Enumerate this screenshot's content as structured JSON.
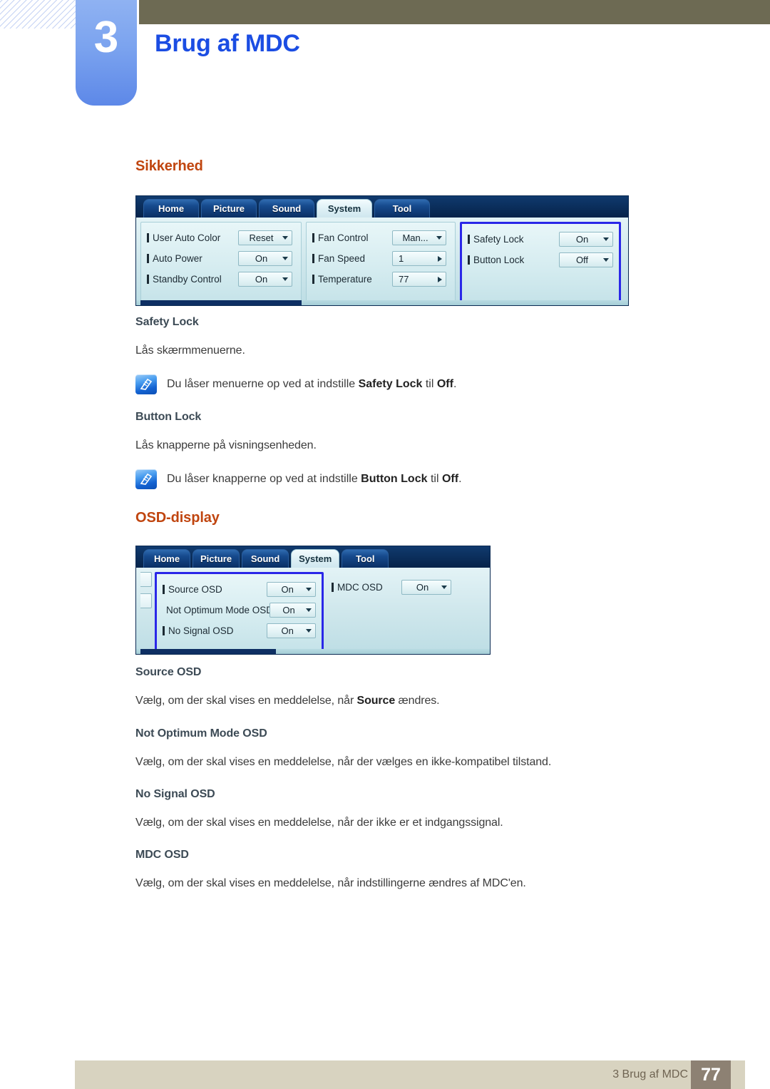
{
  "header": {
    "chapter_number": "3",
    "chapter_title": "Brug af MDC"
  },
  "sections": [
    {
      "heading": "Sikkerhed",
      "subsections": [
        {
          "title": "Safety Lock",
          "body": "Lås skærmmenuerne.",
          "note_pre": "Du låser menuerne op ved at indstille ",
          "note_bold1": "Safety Lock",
          "note_mid": " til ",
          "note_bold2": "Off",
          "note_post": "."
        },
        {
          "title": "Button Lock",
          "body": "Lås knapperne på visningsenheden.",
          "note_pre": "Du låser knapperne op ved at indstille ",
          "note_bold1": "Button Lock",
          "note_mid": " til ",
          "note_bold2": "Off",
          "note_post": "."
        }
      ]
    },
    {
      "heading": "OSD-display",
      "subsections": [
        {
          "title": "Source OSD",
          "body_pre": "Vælg, om der skal vises en meddelelse, når ",
          "body_bold": "Source",
          "body_post": " ændres."
        },
        {
          "title": "Not Optimum Mode OSD",
          "body": "Vælg, om der skal vises en meddelelse, når der vælges en ikke-kompatibel tilstand."
        },
        {
          "title": "No Signal OSD",
          "body": "Vælg, om der skal vises en meddelelse, når der ikke er et indgangssignal."
        },
        {
          "title": "MDC OSD",
          "body": "Vælg, om der skal vises en meddelelse, når indstillingerne ændres af MDC'en."
        }
      ]
    }
  ],
  "mdc_system": {
    "tabs": [
      "Home",
      "Picture",
      "Sound",
      "System",
      "Tool"
    ],
    "active_tab": "System",
    "group1": [
      {
        "label": "User Auto Color",
        "value": "Reset",
        "control": "dropdown"
      },
      {
        "label": "Auto Power",
        "value": "On",
        "control": "dropdown"
      },
      {
        "label": "Standby Control",
        "value": "On",
        "control": "dropdown"
      }
    ],
    "group2": [
      {
        "label": "Fan Control",
        "value": "Man...",
        "control": "dropdown"
      },
      {
        "label": "Fan Speed",
        "value": "1",
        "control": "stepper"
      },
      {
        "label": "Temperature",
        "value": "77",
        "control": "stepper"
      }
    ],
    "group3": [
      {
        "label": "Safety Lock",
        "value": "On",
        "control": "dropdown"
      },
      {
        "label": "Button Lock",
        "value": "Off",
        "control": "dropdown"
      }
    ]
  },
  "mdc_osd": {
    "tabs": [
      "Home",
      "Picture",
      "Sound",
      "System",
      "Tool"
    ],
    "active_tab": "System",
    "group1": [
      {
        "label": "Source OSD",
        "value": "On",
        "control": "dropdown"
      },
      {
        "label": "Not Optimum Mode OSD",
        "value": "On",
        "control": "dropdown"
      },
      {
        "label": "No Signal OSD",
        "value": "On",
        "control": "dropdown"
      }
    ],
    "group2": [
      {
        "label": "MDC OSD",
        "value": "On",
        "control": "dropdown"
      }
    ]
  },
  "footer": {
    "text": "3 Brug af MDC",
    "page": "77"
  },
  "colors": {
    "chapter_title": "#1b4de3",
    "section_heading": "#c0450f",
    "sub_heading": "#3c4a55",
    "olive": "#6d6a53",
    "highlight_border": "#2a27e8",
    "footer_band": "#d8d3c0",
    "footer_page_box": "#8d8173"
  }
}
